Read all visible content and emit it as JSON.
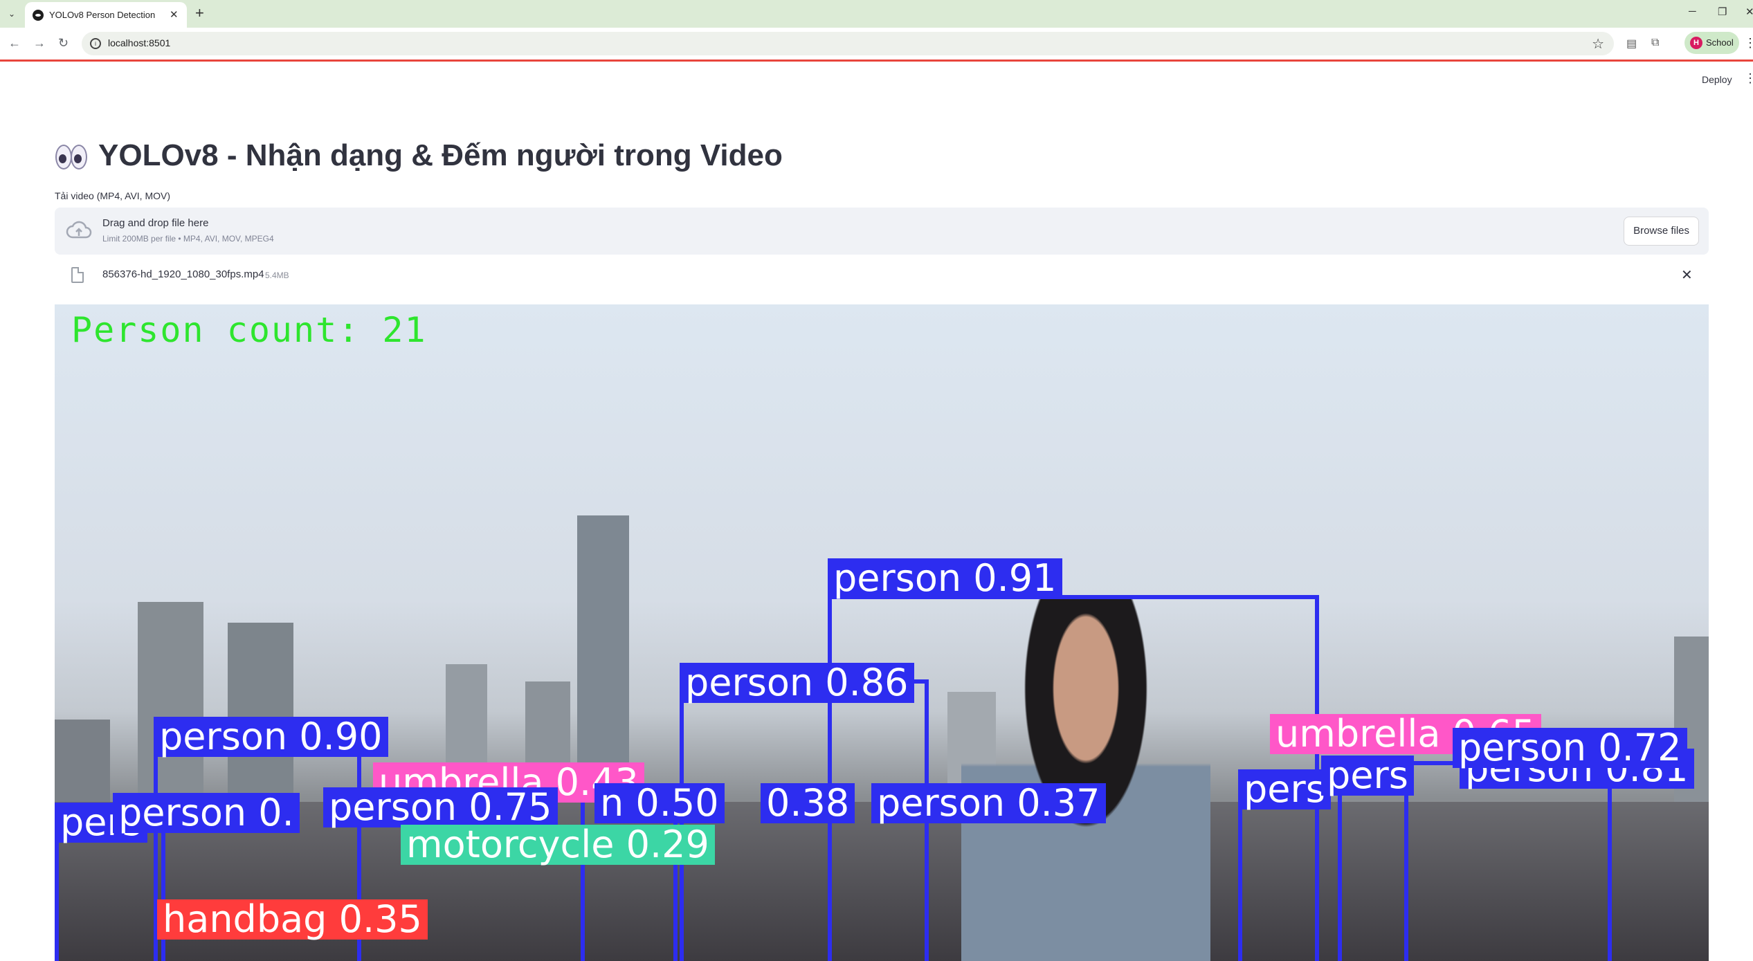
{
  "browser": {
    "tab_title": "YOLOv8 Person Detection",
    "url": "localhost:8501",
    "profile_initial": "H",
    "profile_name": "School"
  },
  "app": {
    "deploy_label": "Deploy",
    "title": "YOLOv8 - Nhận dạng & Đếm người trong Video",
    "uploader": {
      "label": "Tải video (MP4, AVI, MOV)",
      "drop_text": "Drag and drop file here",
      "limit_text": "Limit 200MB per file • MP4, AVI, MOV, MPEG4",
      "browse_label": "Browse files"
    },
    "file": {
      "name": "856376-hd_1920_1080_30fps.mp4",
      "size": "5.4MB"
    },
    "video": {
      "count_text": "Person count: 21",
      "labels": [
        "person 0.91",
        "person 0.86",
        "person 0.90",
        "umbrella 0.43",
        "person 0.75",
        "n 0.50",
        "0.38",
        "person 0.37",
        "motorcycle 0.29",
        "handbag 0.35",
        "umbrella 0.65",
        "person 0.81",
        "person 0.72",
        "pers",
        "person 0.",
        "person_0."
      ]
    }
  }
}
